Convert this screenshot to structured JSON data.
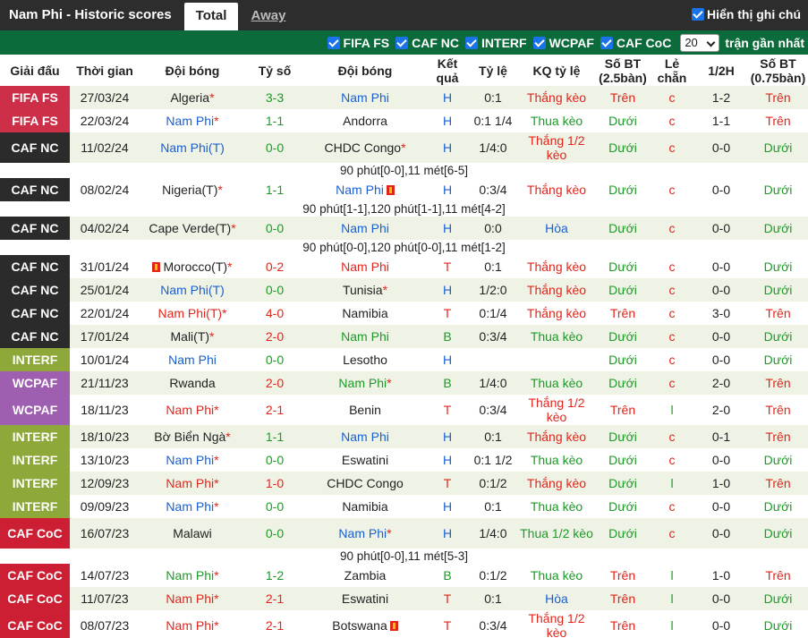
{
  "header": {
    "title": "Nam Phi - Historic scores",
    "tabs": [
      {
        "label": "Total",
        "active": true
      },
      {
        "label": "Away",
        "active": false
      }
    ],
    "show_all_label": "Hiển thị ghi chú"
  },
  "filters": {
    "items": [
      {
        "label": "FIFA FS",
        "checked": true
      },
      {
        "label": "CAF NC",
        "checked": true
      },
      {
        "label": "INTERF",
        "checked": true
      },
      {
        "label": "WCPAF",
        "checked": true
      },
      {
        "label": "CAF CoC",
        "checked": true
      }
    ],
    "count_value": "20",
    "count_label": "trận gần nhất"
  },
  "colors": {
    "FIFA FS": "#cc2f47",
    "CAF NC": "#2b2b2b",
    "INTERF": "#8ea83a",
    "WCPAF": "#9f5fb0",
    "CAF CoC": "#cc1f33",
    "filterbar": "#0b6b3a"
  },
  "columns": [
    "Giải đấu",
    "Thời gian",
    "Đội bóng",
    "Tỷ số",
    "Đội bóng",
    "Kết quả",
    "Tỷ lệ",
    "KQ tỷ lệ",
    "Số BT (2.5bàn)",
    "Lẻ chẵn",
    "1/2H",
    "Số BT (0.75bàn)"
  ],
  "matches": [
    {
      "league": "FIFA FS",
      "date": "27/03/24",
      "home": "Algeria",
      "home_star": true,
      "home_color": "plain",
      "score": "3-3",
      "score_color": "green",
      "away": "Nam Phi",
      "away_star": false,
      "away_color": "blue",
      "result": "H",
      "result_color": "blue",
      "odds": "0:1",
      "odds_res": "Thắng kèo",
      "odds_res_color": "red",
      "ou": "Trên",
      "ou_color": "red",
      "oe": "c",
      "oe_color": "red",
      "half": "1-2",
      "ou2": "Trên",
      "ou2_color": "red"
    },
    {
      "league": "FIFA FS",
      "date": "22/03/24",
      "home": "Nam Phi",
      "home_star": true,
      "home_color": "blue",
      "score": "1-1",
      "score_color": "green",
      "away": "Andorra",
      "away_star": false,
      "away_color": "plain",
      "result": "H",
      "result_color": "blue",
      "odds": "0:1 1/4",
      "odds_res": "Thua kèo",
      "odds_res_color": "green",
      "ou": "Dưới",
      "ou_color": "green",
      "oe": "c",
      "oe_color": "red",
      "half": "1-1",
      "ou2": "Trên",
      "ou2_color": "red"
    },
    {
      "league": "CAF NC",
      "date": "11/02/24",
      "home": "Nam Phi(T)",
      "home_star": false,
      "home_color": "blue",
      "score": "0-0",
      "score_color": "green",
      "away": "CHDC Congo",
      "away_star": true,
      "away_color": "plain",
      "result": "H",
      "result_color": "blue",
      "odds": "1/4:0",
      "odds_res": "Thắng 1/2 kèo",
      "odds_res_color": "red",
      "tall": true,
      "ou": "Dưới",
      "ou_color": "green",
      "oe": "c",
      "oe_color": "red",
      "half": "0-0",
      "ou2": "Dưới",
      "ou2_color": "green",
      "note": "90 phút[0-0],11 mét[6-5]"
    },
    {
      "league": "CAF NC",
      "date": "08/02/24",
      "home": "Nigeria(T)",
      "home_star": true,
      "home_color": "plain",
      "score": "1-1",
      "score_color": "green",
      "away": "Nam Phi",
      "away_star": false,
      "away_color": "blue",
      "away_card": true,
      "result": "H",
      "result_color": "blue",
      "odds": "0:3/4",
      "odds_res": "Thắng kèo",
      "odds_res_color": "red",
      "ou": "Dưới",
      "ou_color": "green",
      "oe": "c",
      "oe_color": "red",
      "half": "0-0",
      "ou2": "Dưới",
      "ou2_color": "green",
      "note": "90 phút[1-1],120 phút[1-1],11 mét[4-2]"
    },
    {
      "league": "CAF NC",
      "date": "04/02/24",
      "home": "Cape Verde(T)",
      "home_star": true,
      "home_color": "plain",
      "score": "0-0",
      "score_color": "green",
      "away": "Nam Phi",
      "away_star": false,
      "away_color": "blue",
      "result": "H",
      "result_color": "blue",
      "odds": "0:0",
      "odds_res": "Hòa",
      "odds_res_color": "blue",
      "ou": "Dưới",
      "ou_color": "green",
      "oe": "c",
      "oe_color": "red",
      "half": "0-0",
      "ou2": "Dưới",
      "ou2_color": "green",
      "note": "90 phút[0-0],120 phút[0-0],11 mét[1-2]"
    },
    {
      "league": "CAF NC",
      "date": "31/01/24",
      "home": "Morocco(T)",
      "home_star": true,
      "home_color": "plain",
      "home_card": true,
      "score": "0-2",
      "score_color": "red",
      "away": "Nam Phi",
      "away_star": false,
      "away_color": "red",
      "result": "T",
      "result_color": "red",
      "odds": "0:1",
      "odds_res": "Thắng kèo",
      "odds_res_color": "red",
      "ou": "Dưới",
      "ou_color": "green",
      "oe": "c",
      "oe_color": "red",
      "half": "0-0",
      "ou2": "Dưới",
      "ou2_color": "green"
    },
    {
      "league": "CAF NC",
      "date": "25/01/24",
      "home": "Nam Phi(T)",
      "home_star": false,
      "home_color": "blue",
      "score": "0-0",
      "score_color": "green",
      "away": "Tunisia",
      "away_star": true,
      "away_color": "plain",
      "result": "H",
      "result_color": "blue",
      "odds": "1/2:0",
      "odds_res": "Thắng kèo",
      "odds_res_color": "red",
      "ou": "Dưới",
      "ou_color": "green",
      "oe": "c",
      "oe_color": "red",
      "half": "0-0",
      "ou2": "Dưới",
      "ou2_color": "green"
    },
    {
      "league": "CAF NC",
      "date": "22/01/24",
      "home": "Nam Phi(T)",
      "home_star": true,
      "home_color": "red",
      "score": "4-0",
      "score_color": "red",
      "away": "Namibia",
      "away_star": false,
      "away_color": "plain",
      "result": "T",
      "result_color": "red",
      "odds": "0:1/4",
      "odds_res": "Thắng kèo",
      "odds_res_color": "red",
      "ou": "Trên",
      "ou_color": "red",
      "oe": "c",
      "oe_color": "red",
      "half": "3-0",
      "ou2": "Trên",
      "ou2_color": "red"
    },
    {
      "league": "CAF NC",
      "date": "17/01/24",
      "home": "Mali(T)",
      "home_star": true,
      "home_color": "plain",
      "score": "2-0",
      "score_color": "red",
      "away": "Nam Phi",
      "away_star": false,
      "away_color": "green",
      "result": "B",
      "result_color": "green",
      "odds": "0:3/4",
      "odds_res": "Thua kèo",
      "odds_res_color": "green",
      "ou": "Dưới",
      "ou_color": "green",
      "oe": "c",
      "oe_color": "red",
      "half": "0-0",
      "ou2": "Dưới",
      "ou2_color": "green"
    },
    {
      "league": "INTERF",
      "date": "10/01/24",
      "home": "Nam Phi",
      "home_star": false,
      "home_color": "blue",
      "score": "0-0",
      "score_color": "green",
      "away": "Lesotho",
      "away_star": false,
      "away_color": "plain",
      "result": "H",
      "result_color": "blue",
      "odds": "",
      "odds_res": "",
      "odds_res_color": "plain",
      "ou": "Dưới",
      "ou_color": "green",
      "oe": "c",
      "oe_color": "red",
      "half": "0-0",
      "ou2": "Dưới",
      "ou2_color": "green"
    },
    {
      "league": "WCPAF",
      "date": "21/11/23",
      "home": "Rwanda",
      "home_star": false,
      "home_color": "plain",
      "score": "2-0",
      "score_color": "red",
      "away": "Nam Phi",
      "away_star": true,
      "away_color": "green",
      "result": "B",
      "result_color": "green",
      "odds": "1/4:0",
      "odds_res": "Thua kèo",
      "odds_res_color": "green",
      "ou": "Dưới",
      "ou_color": "green",
      "oe": "c",
      "oe_color": "red",
      "half": "2-0",
      "ou2": "Trên",
      "ou2_color": "red"
    },
    {
      "league": "WCPAF",
      "date": "18/11/23",
      "home": "Nam Phi",
      "home_star": true,
      "home_color": "red",
      "score": "2-1",
      "score_color": "red",
      "away": "Benin",
      "away_star": false,
      "away_color": "plain",
      "result": "T",
      "result_color": "red",
      "odds": "0:3/4",
      "odds_res": "Thắng 1/2 kèo",
      "odds_res_color": "red",
      "tall": true,
      "ou": "Trên",
      "ou_color": "red",
      "oe": "l",
      "oe_color": "green",
      "half": "2-0",
      "ou2": "Trên",
      "ou2_color": "red"
    },
    {
      "league": "INTERF",
      "date": "18/10/23",
      "home": "Bờ Biển Ngà",
      "home_star": true,
      "home_color": "plain",
      "score": "1-1",
      "score_color": "green",
      "away": "Nam Phi",
      "away_star": false,
      "away_color": "blue",
      "result": "H",
      "result_color": "blue",
      "odds": "0:1",
      "odds_res": "Thắng kèo",
      "odds_res_color": "red",
      "ou": "Dưới",
      "ou_color": "green",
      "oe": "c",
      "oe_color": "red",
      "half": "0-1",
      "ou2": "Trên",
      "ou2_color": "red"
    },
    {
      "league": "INTERF",
      "date": "13/10/23",
      "home": "Nam Phi",
      "home_star": true,
      "home_color": "blue",
      "score": "0-0",
      "score_color": "green",
      "away": "Eswatini",
      "away_star": false,
      "away_color": "plain",
      "result": "H",
      "result_color": "blue",
      "odds": "0:1 1/2",
      "odds_res": "Thua kèo",
      "odds_res_color": "green",
      "ou": "Dưới",
      "ou_color": "green",
      "oe": "c",
      "oe_color": "red",
      "half": "0-0",
      "ou2": "Dưới",
      "ou2_color": "green"
    },
    {
      "league": "INTERF",
      "date": "12/09/23",
      "home": "Nam Phi",
      "home_star": true,
      "home_color": "red",
      "score": "1-0",
      "score_color": "red",
      "away": "CHDC Congo",
      "away_star": false,
      "away_color": "plain",
      "result": "T",
      "result_color": "red",
      "odds": "0:1/2",
      "odds_res": "Thắng kèo",
      "odds_res_color": "red",
      "ou": "Dưới",
      "ou_color": "green",
      "oe": "l",
      "oe_color": "green",
      "half": "1-0",
      "ou2": "Trên",
      "ou2_color": "red"
    },
    {
      "league": "INTERF",
      "date": "09/09/23",
      "home": "Nam Phi",
      "home_star": true,
      "home_color": "blue",
      "score": "0-0",
      "score_color": "green",
      "away": "Namibia",
      "away_star": false,
      "away_color": "plain",
      "result": "H",
      "result_color": "blue",
      "odds": "0:1",
      "odds_res": "Thua kèo",
      "odds_res_color": "green",
      "ou": "Dưới",
      "ou_color": "green",
      "oe": "c",
      "oe_color": "red",
      "half": "0-0",
      "ou2": "Dưới",
      "ou2_color": "green"
    },
    {
      "league": "CAF CoC",
      "date": "16/07/23",
      "home": "Malawi",
      "home_star": false,
      "home_color": "plain",
      "score": "0-0",
      "score_color": "green",
      "away": "Nam Phi",
      "away_star": true,
      "away_color": "blue",
      "result": "H",
      "result_color": "blue",
      "odds": "1/4:0",
      "odds_res": "Thua 1/2 kèo",
      "odds_res_color": "green",
      "tall": true,
      "ou": "Dưới",
      "ou_color": "green",
      "oe": "c",
      "oe_color": "red",
      "half": "0-0",
      "ou2": "Dưới",
      "ou2_color": "green",
      "note": "90 phút[0-0],11 mét[5-3]"
    },
    {
      "league": "CAF CoC",
      "date": "14/07/23",
      "home": "Nam Phi",
      "home_star": true,
      "home_color": "green",
      "score": "1-2",
      "score_color": "green",
      "away": "Zambia",
      "away_star": false,
      "away_color": "plain",
      "result": "B",
      "result_color": "green",
      "odds": "0:1/2",
      "odds_res": "Thua kèo",
      "odds_res_color": "green",
      "ou": "Trên",
      "ou_color": "red",
      "oe": "l",
      "oe_color": "green",
      "half": "1-0",
      "ou2": "Trên",
      "ou2_color": "red"
    },
    {
      "league": "CAF CoC",
      "date": "11/07/23",
      "home": "Nam Phi",
      "home_star": true,
      "home_color": "red",
      "score": "2-1",
      "score_color": "red",
      "away": "Eswatini",
      "away_star": false,
      "away_color": "plain",
      "result": "T",
      "result_color": "red",
      "odds": "0:1",
      "odds_res": "Hòa",
      "odds_res_color": "blue",
      "ou": "Trên",
      "ou_color": "red",
      "oe": "l",
      "oe_color": "green",
      "half": "0-0",
      "ou2": "Dưới",
      "ou2_color": "green"
    },
    {
      "league": "CAF CoC",
      "date": "08/07/23",
      "home": "Nam Phi",
      "home_star": true,
      "home_color": "red",
      "score": "2-1",
      "score_color": "red",
      "away": "Botswana",
      "away_star": false,
      "away_color": "plain",
      "away_card": true,
      "result": "T",
      "result_color": "red",
      "odds": "0:3/4",
      "odds_res": "Thắng 1/2 kèo",
      "odds_res_color": "red",
      "tall": true,
      "ou": "Trên",
      "ou_color": "red",
      "oe": "l",
      "oe_color": "green",
      "half": "0-0",
      "ou2": "Dưới",
      "ou2_color": "green"
    }
  ]
}
